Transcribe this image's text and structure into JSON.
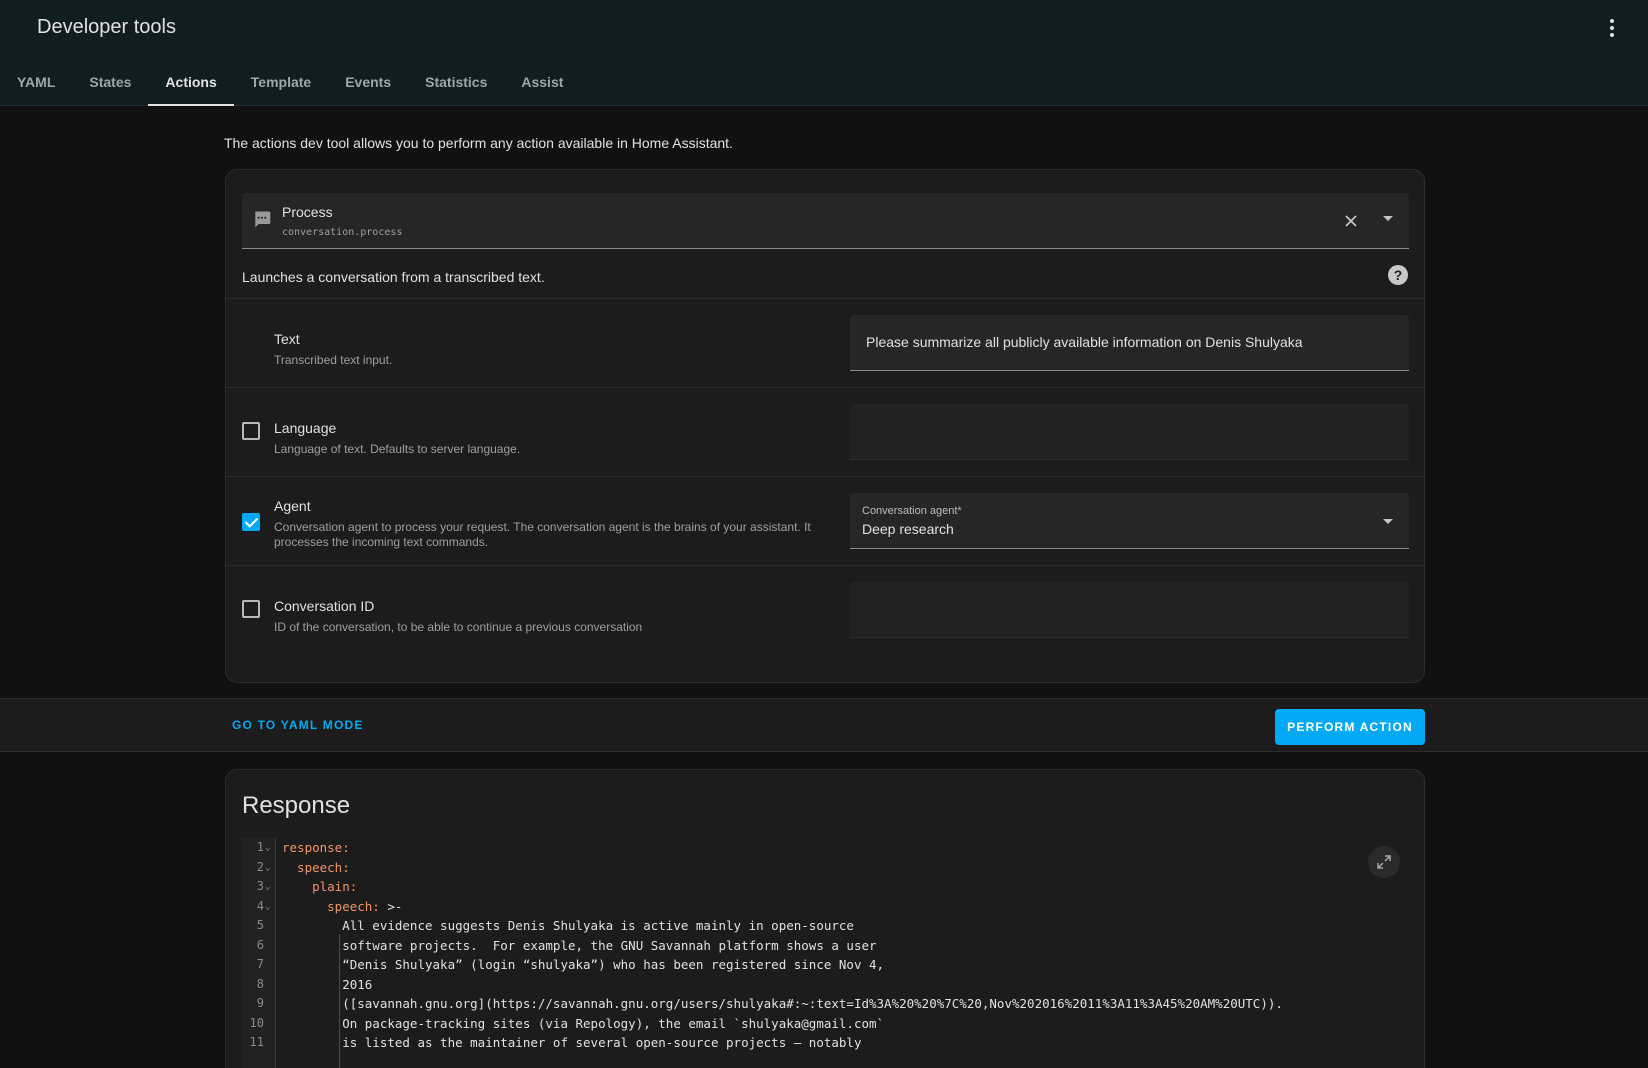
{
  "header": {
    "title": "Developer tools",
    "tabs": [
      {
        "label": "YAML",
        "active": false
      },
      {
        "label": "States",
        "active": false
      },
      {
        "label": "Actions",
        "active": true
      },
      {
        "label": "Template",
        "active": false
      },
      {
        "label": "Events",
        "active": false
      },
      {
        "label": "Statistics",
        "active": false
      },
      {
        "label": "Assist",
        "active": false
      }
    ]
  },
  "intro": "The actions dev tool allows you to perform any action available in Home Assistant.",
  "action": {
    "name": "Process",
    "id": "conversation.process",
    "description": "Launches a conversation from a transcribed text.",
    "icon": "message-processing-icon"
  },
  "fields": {
    "text": {
      "label": "Text",
      "description": "Transcribed text input.",
      "value": "Please summarize all publicly available information on Denis Shulyaka"
    },
    "language": {
      "label": "Language",
      "description": "Language of text. Defaults to server language.",
      "checked": false
    },
    "agent": {
      "label": "Agent",
      "description": "Conversation agent to process your request. The conversation agent is the brains of your assistant. It processes the incoming text commands.",
      "checked": true,
      "select_label": "Conversation agent*",
      "select_value": "Deep research"
    },
    "conversation_id": {
      "label": "Conversation ID",
      "description": "ID of the conversation, to be able to continue a previous conversation",
      "checked": false
    }
  },
  "buttons": {
    "yaml_mode": "GO TO YAML MODE",
    "perform": "PERFORM ACTION"
  },
  "response": {
    "title": "Response",
    "lines": [
      {
        "n": "1",
        "fold": true,
        "key": "response:",
        "text": ""
      },
      {
        "n": "2",
        "fold": true,
        "key": "  speech:",
        "text": ""
      },
      {
        "n": "3",
        "fold": true,
        "key": "    plain:",
        "text": ""
      },
      {
        "n": "4",
        "fold": true,
        "key": "      speech:",
        "text": " >-"
      },
      {
        "n": "5",
        "fold": false,
        "key": "",
        "text": "        All evidence suggests Denis Shulyaka is active mainly in open-source"
      },
      {
        "n": "6",
        "fold": false,
        "key": "",
        "text": "        software projects.  For example, the GNU Savannah platform shows a user"
      },
      {
        "n": "7",
        "fold": false,
        "key": "",
        "text": "        “Denis Shulyaka” (login “shulyaka”) who has been registered since Nov 4,"
      },
      {
        "n": "8",
        "fold": false,
        "key": "",
        "text": "        2016"
      },
      {
        "n": "9",
        "fold": false,
        "key": "",
        "text": "        ([savannah.gnu.org](https://savannah.gnu.org/users/shulyaka#:~:text=Id%3A%20%20%7C%20,Nov%202016%2011%3A11%3A45%20AM%20UTC))."
      },
      {
        "n": "10",
        "fold": false,
        "key": "",
        "text": "        On package-tracking sites (via Repology), the email `shulyaka@gmail.com`"
      },
      {
        "n": "11",
        "fold": false,
        "key": "",
        "text": "        is listed as the maintainer of several open-source projects — notably"
      }
    ]
  }
}
